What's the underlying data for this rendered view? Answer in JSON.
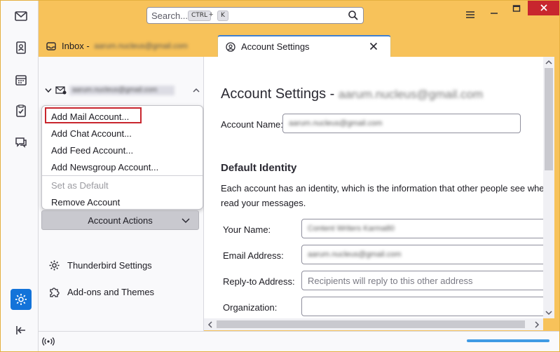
{
  "window": {
    "search_placeholder": "Search...",
    "search_key_ctrl": "CTRL",
    "search_plus": "+",
    "search_key_k": "K"
  },
  "tabs": [
    {
      "label": "Inbox - ",
      "account": "aarum.nucleus@gmail.com",
      "icon": "inbox-icon"
    },
    {
      "label": "Account Settings",
      "icon": "account-settings-icon"
    }
  ],
  "folder_pane": {
    "account_name": "aarum.nucleus@gmail.com",
    "menu": {
      "items": [
        {
          "label": "Add Mail Account...",
          "enabled": true
        },
        {
          "label": "Add Chat Account...",
          "enabled": true
        },
        {
          "label": "Add Feed Account...",
          "enabled": true
        },
        {
          "label": "Add Newsgroup Account...",
          "enabled": true
        },
        {
          "label": "Set as Default",
          "enabled": false
        },
        {
          "label": "Remove Account",
          "enabled": true
        }
      ]
    },
    "account_actions_label": "Account Actions",
    "links": [
      {
        "label": "Thunderbird Settings",
        "icon": "gear-icon"
      },
      {
        "label": "Add-ons and Themes",
        "icon": "puzzle-icon"
      }
    ]
  },
  "settings": {
    "title": "Account Settings - ",
    "title_account": "aarum.nucleus@gmail.com",
    "account_name_label": "Account Name:",
    "account_name_value": "aarum.nucleus@gmail.com",
    "section_title": "Default Identity",
    "description_line1": "Each account has an identity, which is the information that other people see when they",
    "description_line2": "read your messages.",
    "your_name_label": "Your Name:",
    "your_name_value": "Content Writers Karma80",
    "email_label": "Email Address:",
    "email_value": "aarum.nucleus@gmail.com",
    "reply_to_label": "Reply-to Address:",
    "reply_to_placeholder": "Recipients will reply to this other address",
    "organization_label": "Organization:"
  },
  "colors": {
    "titlebar": "#f7c25a",
    "accent": "#1373d9",
    "highlight_box": "#c8262e"
  }
}
